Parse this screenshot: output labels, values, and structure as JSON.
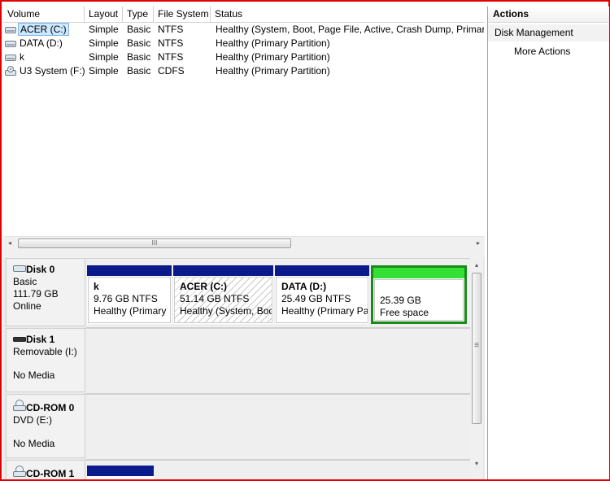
{
  "columns": [
    "Volume",
    "Layout",
    "Type",
    "File System",
    "Status"
  ],
  "volumes": [
    {
      "name": "ACER (C:)",
      "layout": "Simple",
      "type": "Basic",
      "fs": "NTFS",
      "status": "Healthy (System, Boot, Page File, Active, Crash Dump, Primary",
      "icon": "drive-icon"
    },
    {
      "name": "DATA (D:)",
      "layout": "Simple",
      "type": "Basic",
      "fs": "NTFS",
      "status": "Healthy (Primary Partition)",
      "icon": "drive-icon"
    },
    {
      "name": "k",
      "layout": "Simple",
      "type": "Basic",
      "fs": "NTFS",
      "status": "Healthy (Primary Partition)",
      "icon": "drive-icon"
    },
    {
      "name": "U3 System (F:)",
      "layout": "Simple",
      "type": "Basic",
      "fs": "CDFS",
      "status": "Healthy (Primary Partition)",
      "icon": "cd-drive-icon"
    }
  ],
  "hscroll": {
    "left_arrow": "◂",
    "grip": "III",
    "right_arrow": "▸"
  },
  "disks": [
    {
      "name": "Disk 0",
      "kind": "Basic",
      "size": "111.79 GB",
      "state": "Online",
      "partitions": [
        {
          "name": "k",
          "size": "9.76 GB NTFS",
          "status": "Healthy (Primary"
        },
        {
          "name": "ACER  (C:)",
          "size": "51.14 GB NTFS",
          "status": "Healthy (System, Boo"
        },
        {
          "name": "DATA  (D:)",
          "size": "25.49 GB NTFS",
          "status": "Healthy (Primary Pa"
        },
        {
          "name": "",
          "size": "25.39 GB",
          "status": "Free space"
        }
      ]
    },
    {
      "name": "Disk 1",
      "kind": "Removable (I:)",
      "size": "",
      "state": "No Media"
    },
    {
      "name": "CD-ROM 0",
      "kind": "DVD (E:)",
      "size": "",
      "state": "No Media"
    },
    {
      "name": "CD-ROM 1",
      "kind": "",
      "size": "",
      "state": ""
    }
  ],
  "vscroll": {
    "up": "▴",
    "grip": "≡",
    "down": "▾"
  },
  "actions": {
    "title": "Actions",
    "section": "Disk Management",
    "item": "More Actions"
  },
  "colors": {
    "partition_bar": "#0a1a8a",
    "free_space_bar": "#33e033",
    "selection": "#cde8ff",
    "border_highlight": "#e00000"
  }
}
